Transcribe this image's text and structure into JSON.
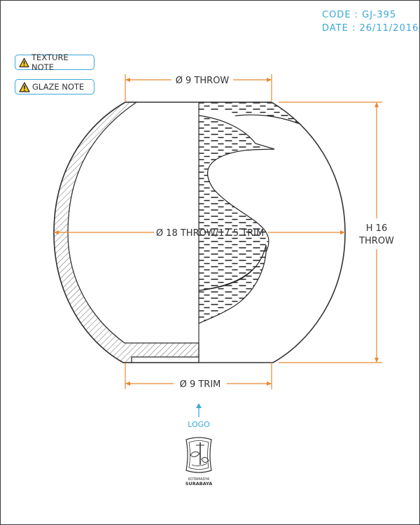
{
  "header": {
    "code": "CODE : GJ-395",
    "date": "DATE : 26/11/2016"
  },
  "notes": {
    "texture_label": "TEXTURE NOTE",
    "glaze_label": "GLAZE NOTE"
  },
  "dimensions": {
    "top_width": "Ø 9 THROW",
    "body_diameter": "Ø 18 THROW/17.5 TRIM",
    "height_line1": "H 16",
    "height_line2": "THROW",
    "base_width": "Ø 9 TRIM"
  },
  "logo": {
    "label": "LOGO",
    "emblem_line1": "KOTAMADYA",
    "emblem_line2": "SURABAYA"
  },
  "colors": {
    "dimension": "#e8892f",
    "accent": "#3aa8d8",
    "outline": "#333333"
  },
  "icons": {
    "note": "warning-triangle-icon",
    "arrow": "arrow-up-icon"
  }
}
